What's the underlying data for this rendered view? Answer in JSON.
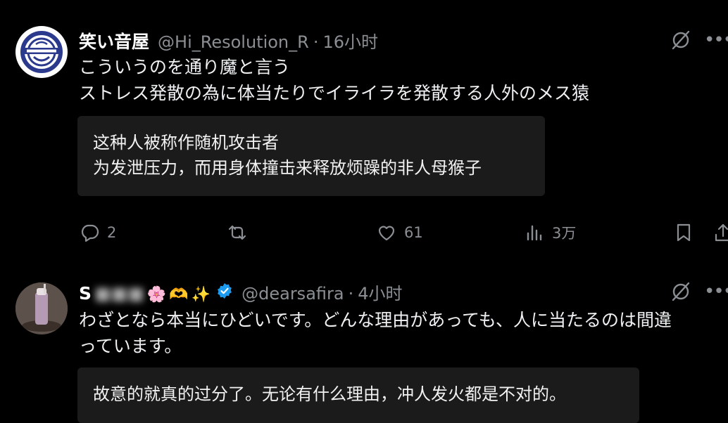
{
  "posts": [
    {
      "author_name": "笑い音屋",
      "handle": "@Hi_Resolution_R",
      "separator": "·",
      "time": "16小时",
      "text_lines": [
        "こういうのを通り魔と言う",
        "ストレス発散の為に体当たりでイライラを発散する人外のメス猿"
      ],
      "translation_lines": [
        "这种人被称作随机攻击者",
        "为发泄压力，而用身体撞击来释放烦躁的非人母猴子"
      ],
      "actions": {
        "replies": "2",
        "reposts": "",
        "likes": "61",
        "views": "3万"
      }
    },
    {
      "author_name": "S",
      "author_name_obscured": true,
      "emojis": [
        "🌸",
        "🫶",
        "✨"
      ],
      "verified": true,
      "handle": "@dearsafira",
      "separator": "·",
      "time": "4小时",
      "text_lines": [
        "わざとなら本当にひどいです。どんな理由があっても、人に当たるのは間違",
        "っています。"
      ],
      "translation_lines": [
        "故意的就真的过分了。无论有什么理由，冲人发火都是不对的。"
      ]
    }
  ],
  "colors": {
    "background": "#000000",
    "text": "#e7e9ea",
    "secondary": "#8b8f94",
    "translation_bg": "#1b1b1b",
    "verified": "#1d9bf0"
  }
}
